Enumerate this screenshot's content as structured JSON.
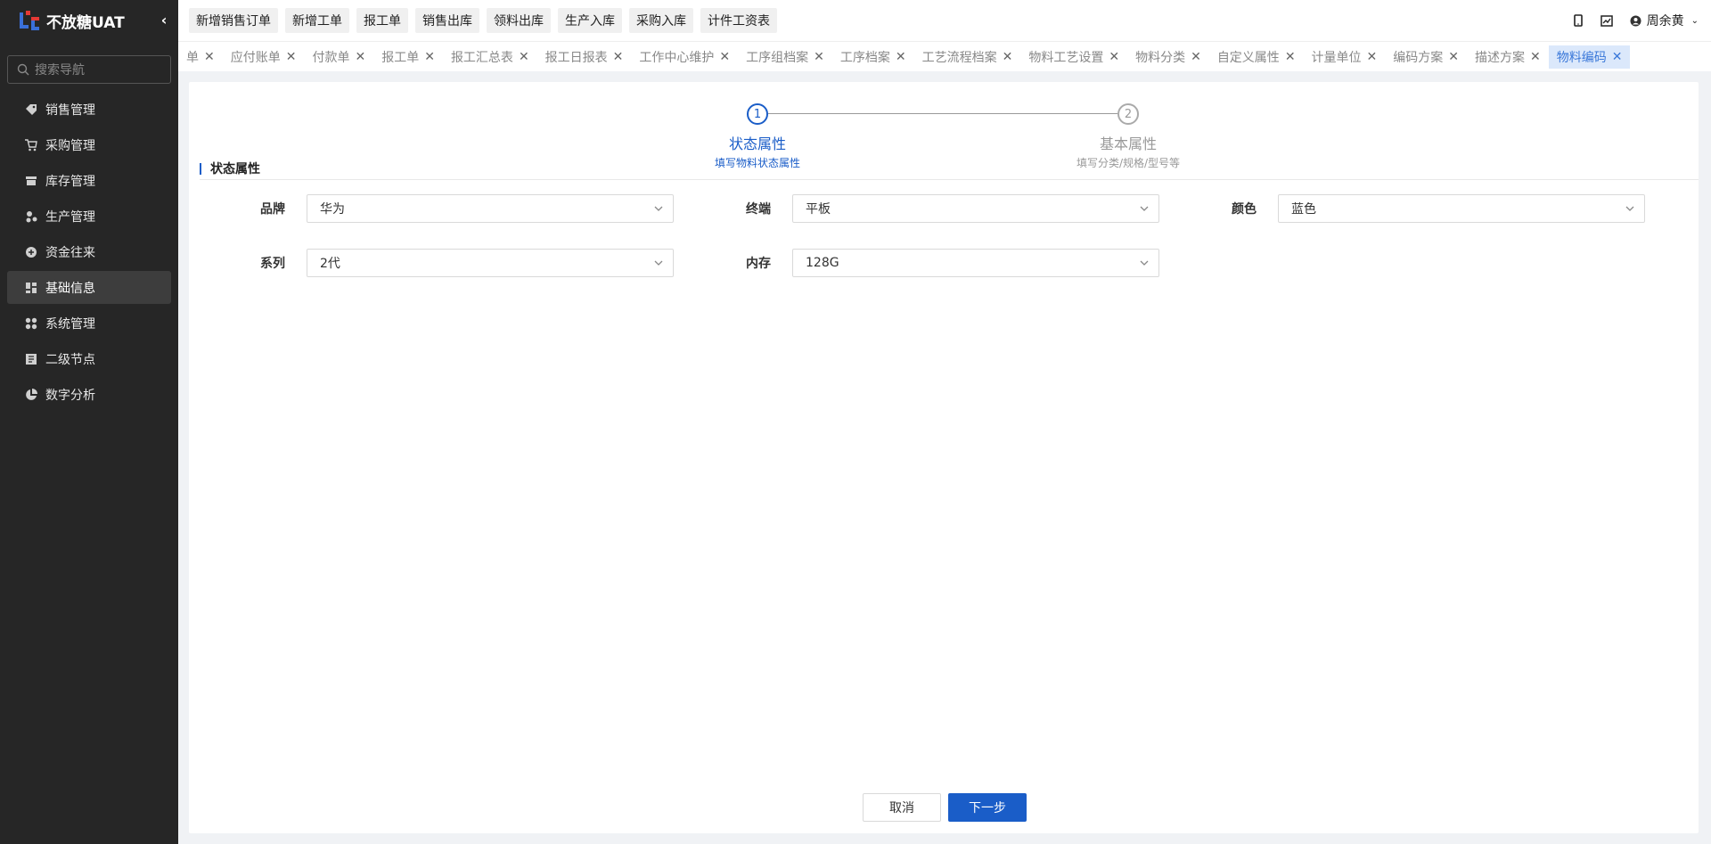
{
  "brand": {
    "name": "不放糖UAT"
  },
  "sidebar": {
    "search_placeholder": "搜索导航",
    "items": [
      {
        "label": "销售管理",
        "icon": "tag-icon"
      },
      {
        "label": "采购管理",
        "icon": "cart-icon"
      },
      {
        "label": "库存管理",
        "icon": "inventory-icon"
      },
      {
        "label": "生产管理",
        "icon": "production-icon"
      },
      {
        "label": "资金往来",
        "icon": "fund-icon"
      },
      {
        "label": "基础信息",
        "icon": "basic-info-icon",
        "active": true
      },
      {
        "label": "系统管理",
        "icon": "system-icon"
      },
      {
        "label": "二级节点",
        "icon": "node-icon"
      },
      {
        "label": "数字分析",
        "icon": "pie-chart-icon"
      }
    ]
  },
  "topbar": {
    "quick_buttons": [
      "新增销售订单",
      "新增工单",
      "报工单",
      "销售出库",
      "领料出库",
      "生产入库",
      "采购入库",
      "计件工资表"
    ],
    "user_name": "周余黄"
  },
  "tabs": {
    "items": [
      "单",
      "应付账单",
      "付款单",
      "报工单",
      "报工汇总表",
      "报工日报表",
      "工作中心维护",
      "工序组档案",
      "工序档案",
      "工艺流程档案",
      "物料工艺设置",
      "物料分类",
      "自定义属性",
      "计量单位",
      "编码方案",
      "描述方案"
    ],
    "active": "物料编码"
  },
  "steps": {
    "s1": {
      "num": "1",
      "title": "状态属性",
      "desc": "填写物料状态属性"
    },
    "s2": {
      "num": "2",
      "title": "基本属性",
      "desc": "填写分类/规格/型号等"
    }
  },
  "section": {
    "title": "状态属性"
  },
  "form": {
    "brand": {
      "label": "品牌",
      "value": "华为"
    },
    "terminal": {
      "label": "终端",
      "value": "平板"
    },
    "color": {
      "label": "颜色",
      "value": "蓝色"
    },
    "series": {
      "label": "系列",
      "value": "2代"
    },
    "memory": {
      "label": "内存",
      "value": "128G"
    }
  },
  "actions": {
    "cancel": "取消",
    "next": "下一步"
  },
  "colors": {
    "accent": "#1a5dc8",
    "sidebar_bg": "#262626"
  }
}
